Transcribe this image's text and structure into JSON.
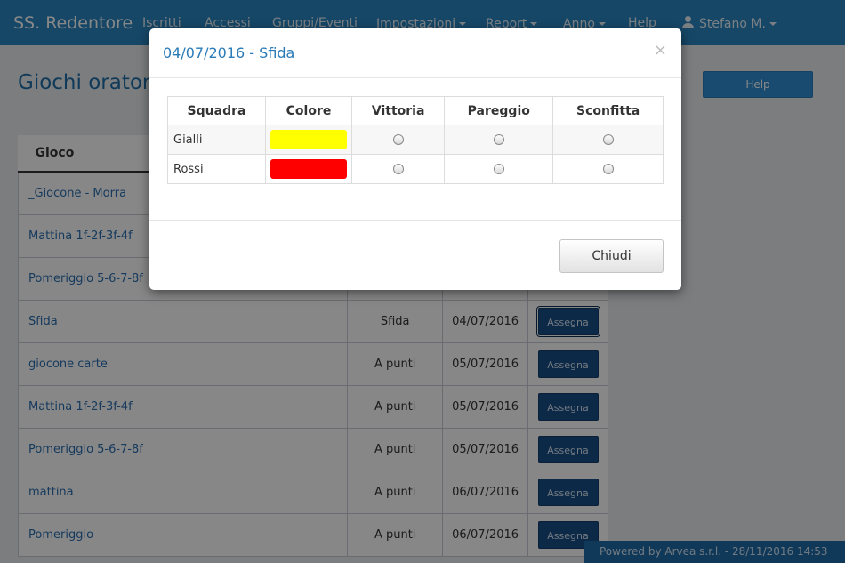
{
  "navbar": {
    "brand": "SS. Redentore",
    "items": [
      {
        "label": "Iscritti",
        "dropdown": false
      },
      {
        "label": "Accessi",
        "dropdown": false
      },
      {
        "label": "Gruppi/Eventi",
        "dropdown": false
      },
      {
        "label": "Impostazioni",
        "dropdown": true
      },
      {
        "label": "Report",
        "dropdown": true
      },
      {
        "label": "Anno",
        "dropdown": true
      },
      {
        "label": "Help",
        "dropdown": false
      }
    ],
    "user": {
      "name": "Stefano M.",
      "icon": "user-icon"
    }
  },
  "page": {
    "title": "Giochi oratori",
    "help_button": "Help"
  },
  "games_table": {
    "header": {
      "name": "Gioco"
    },
    "rows": [
      {
        "name": "_Giocone - Morra",
        "type": "",
        "date": "",
        "action": ""
      },
      {
        "name": "Mattina 1f-2f-3f-4f",
        "type": "",
        "date": "",
        "action": ""
      },
      {
        "name": "Pomeriggio 5-6-7-8f",
        "type": "",
        "date": "",
        "action": ""
      },
      {
        "name": "Sfida",
        "type": "Sfida",
        "date": "04/07/2016",
        "action": "Assegna"
      },
      {
        "name": "giocone carte",
        "type": "A punti",
        "date": "05/07/2016",
        "action": "Assegna"
      },
      {
        "name": "Mattina 1f-2f-3f-4f",
        "type": "A punti",
        "date": "05/07/2016",
        "action": "Assegna"
      },
      {
        "name": "Pomeriggio 5-6-7-8f",
        "type": "A punti",
        "date": "05/07/2016",
        "action": "Assegna"
      },
      {
        "name": "mattina",
        "type": "A punti",
        "date": "06/07/2016",
        "action": "Assegna"
      },
      {
        "name": "Pomeriggio",
        "type": "A punti",
        "date": "06/07/2016",
        "action": "Assegna"
      }
    ]
  },
  "footer": {
    "text": "Powered by Arvea s.r.l. - 28/11/2016 14:53"
  },
  "modal": {
    "title": "04/07/2016 - Sfida",
    "close_symbol": "×",
    "columns": [
      "Squadra",
      "Colore",
      "Vittoria",
      "Pareggio",
      "Sconfitta"
    ],
    "teams": [
      {
        "name": "Gialli",
        "color": "#ffff00"
      },
      {
        "name": "Rossi",
        "color": "#ff0000"
      }
    ],
    "close_button": "Chiudi"
  },
  "colors": {
    "navbar": "#2a86c3",
    "accent": "#2a7bb8",
    "assign_button": "#184e86"
  }
}
